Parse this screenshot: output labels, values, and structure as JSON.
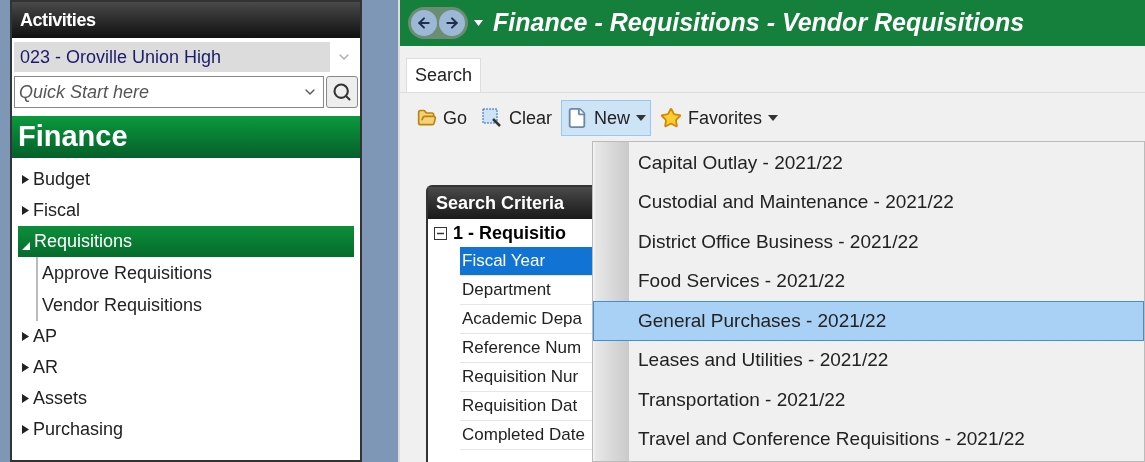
{
  "sidebar": {
    "title": "Activities",
    "district": {
      "value": "023 - Oroville Union High"
    },
    "quick_start": {
      "placeholder": "Quick Start here"
    },
    "section": "Finance",
    "tree": [
      {
        "label": "Budget",
        "expanded": false,
        "selected": false
      },
      {
        "label": "Fiscal",
        "expanded": false,
        "selected": false
      },
      {
        "label": "Requisitions",
        "expanded": true,
        "selected": true,
        "children": [
          {
            "label": "Approve Requisitions",
            "selected": false
          },
          {
            "label": "Vendor Requisitions",
            "selected": false
          }
        ]
      },
      {
        "label": "AP",
        "expanded": false,
        "selected": false
      },
      {
        "label": "AR",
        "expanded": false,
        "selected": false
      },
      {
        "label": "Assets",
        "expanded": false,
        "selected": false
      },
      {
        "label": "Purchasing",
        "expanded": false,
        "selected": false
      }
    ]
  },
  "main": {
    "title": "Finance - Requisitions - Vendor Requisitions",
    "tabs": [
      {
        "label": "Search",
        "selected": true
      }
    ],
    "toolbar": [
      {
        "label": "Go",
        "kind": "go",
        "dropdown": false,
        "pressed": false
      },
      {
        "label": "Clear",
        "kind": "clear",
        "dropdown": false,
        "pressed": false
      },
      {
        "label": "New",
        "kind": "new",
        "dropdown": true,
        "pressed": true
      },
      {
        "label": "Favorites",
        "kind": "favorites",
        "dropdown": true,
        "pressed": false
      }
    ],
    "criteria": {
      "title": "Search Criteria",
      "group": {
        "label": "1 - Requisitio",
        "expanded": true
      },
      "fields": [
        {
          "label": "Fiscal Year",
          "selected": true
        },
        {
          "label": "Department",
          "selected": false
        },
        {
          "label": "Academic Depa",
          "selected": false
        },
        {
          "label": "Reference Num",
          "selected": false
        },
        {
          "label": "Requisition Nur",
          "selected": false
        },
        {
          "label": "Requisition Dat",
          "selected": false
        },
        {
          "label": "Completed Date",
          "selected": false
        }
      ]
    },
    "new_menu": [
      {
        "label": "Capital Outlay - 2021/22",
        "selected": false
      },
      {
        "label": "Custodial and Maintenance - 2021/22",
        "selected": false
      },
      {
        "label": "District Office Business - 2021/22",
        "selected": false
      },
      {
        "label": "Food Services - 2021/22",
        "selected": false
      },
      {
        "label": "General Purchases - 2021/22",
        "selected": true
      },
      {
        "label": "Leases and Utilities - 2021/22",
        "selected": false
      },
      {
        "label": "Transportation - 2021/22",
        "selected": false
      },
      {
        "label": "Travel and Conference Requisitions - 2021/22",
        "selected": false
      }
    ]
  }
}
